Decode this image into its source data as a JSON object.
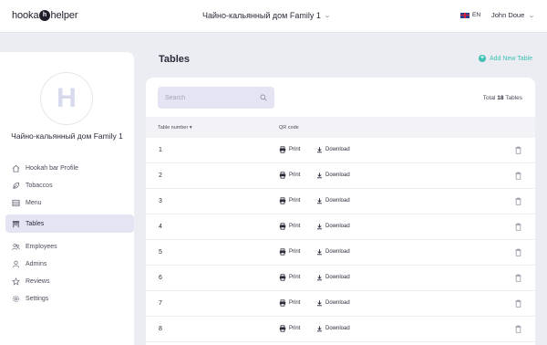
{
  "header": {
    "logo": {
      "prefix": "hooka",
      "mark": "h",
      "suffix": "helper"
    },
    "venue_select": "Чайно-кальянный дом Family 1",
    "language": "EN",
    "user_name": "John Doue"
  },
  "sidebar": {
    "avatar_letter": "H",
    "venue_name": "Чайно-кальянный дом Family 1",
    "items": [
      {
        "label": "Hookah bar Profile",
        "icon": "home-icon",
        "active": false
      },
      {
        "label": "Tobaccos",
        "icon": "leaf-icon",
        "active": false
      },
      {
        "label": "Menu",
        "icon": "menu-list-icon",
        "active": false
      },
      {
        "label": "Tables",
        "icon": "tables-icon",
        "active": true
      },
      {
        "label": "Employees",
        "icon": "employees-icon",
        "active": false
      },
      {
        "label": "Admins",
        "icon": "user-icon",
        "active": false
      },
      {
        "label": "Reviews",
        "icon": "star-icon",
        "active": false
      },
      {
        "label": "Settings",
        "icon": "gear-icon",
        "active": false
      }
    ]
  },
  "main": {
    "title": "Tables",
    "add_button": "Add New Table",
    "search_placeholder": "Search",
    "total_label": "Total",
    "total_count": "18",
    "total_suffix": "Tables",
    "columns": {
      "number": "Table number",
      "qr": "QR code"
    },
    "print_label": "Print",
    "download_label": "Download",
    "rows": [
      "1",
      "2",
      "3",
      "4",
      "5",
      "6",
      "7",
      "8"
    ]
  },
  "colors": {
    "accent": "#3EC1B4",
    "active_bg": "#E4E4F2",
    "page_bg": "#ECEDF2"
  }
}
